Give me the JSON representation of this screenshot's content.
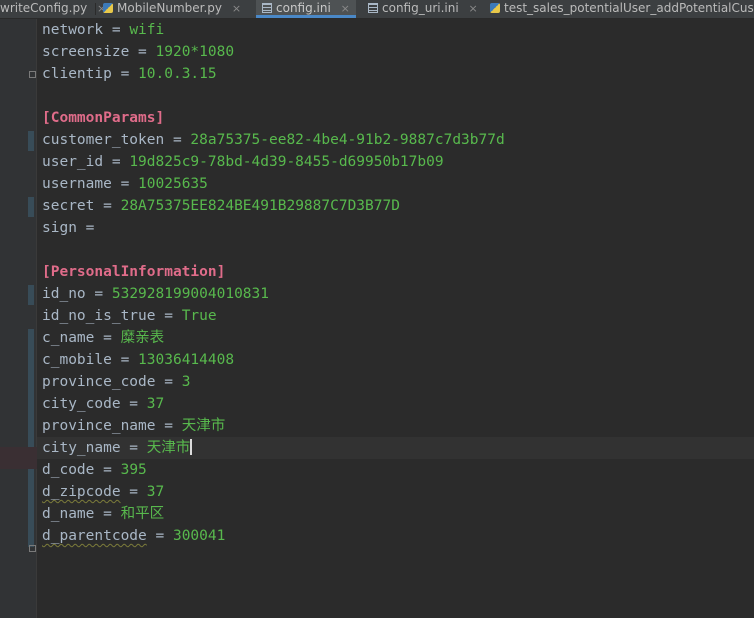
{
  "tabs": [
    {
      "label": "writeConfig.py",
      "icon": "python-file-icon",
      "active": false
    },
    {
      "label": "MobileNumber.py",
      "icon": "python-file-icon",
      "active": false
    },
    {
      "label": "config.ini",
      "icon": "ini-file-icon",
      "active": true
    },
    {
      "label": "config_uri.ini",
      "icon": "ini-file-icon",
      "active": false
    },
    {
      "label": "test_sales_potentialUser_addPotentialCusto",
      "icon": "python-file-icon",
      "active": false
    }
  ],
  "close_glyph": "×",
  "lines": [
    {
      "key": "network",
      "sep": " = ",
      "value": "wifi"
    },
    {
      "key": "screensize",
      "sep": " = ",
      "value": "1920*1080"
    },
    {
      "key": "clientip",
      "sep": " = ",
      "value": "10.0.3.15"
    },
    {
      "section": ""
    },
    {
      "section": "[CommonParams]"
    },
    {
      "key": "customer_token",
      "sep": " = ",
      "value": "28a75375-ee82-4be4-91b2-9887c7d3b77d"
    },
    {
      "key": "user_id",
      "sep": " = ",
      "value": "19d825c9-78bd-4d39-8455-d69950b17b09"
    },
    {
      "key": "username",
      "sep": " = ",
      "value": "10025635"
    },
    {
      "key": "secret",
      "sep": " = ",
      "value": "28A75375EE824BE491B29887C7D3B77D"
    },
    {
      "key": "sign",
      "sep": " =",
      "value": ""
    },
    {
      "section": ""
    },
    {
      "section": "[PersonalInformation]"
    },
    {
      "key": "id_no",
      "sep": " = ",
      "value": "532928199004010831"
    },
    {
      "key": "id_no_is_true",
      "sep": " = ",
      "value": "True"
    },
    {
      "key": "c_name",
      "sep": " = ",
      "value": "糜亲表"
    },
    {
      "key": "c_mobile",
      "sep": " = ",
      "value": "13036414408"
    },
    {
      "key": "province_code",
      "sep": " = ",
      "value": "3"
    },
    {
      "key": "city_code",
      "sep": " = ",
      "value": "37"
    },
    {
      "key": "province_name",
      "sep": " = ",
      "value": "天津市"
    },
    {
      "key": "city_name",
      "sep": " = ",
      "value": "天津市"
    },
    {
      "key": "d_code",
      "sep": " = ",
      "value": "395"
    },
    {
      "key": "d_zipcode",
      "sep": " = ",
      "value": "37"
    },
    {
      "key": "d_name",
      "sep": " = ",
      "value": "和平区"
    },
    {
      "key": "d_parentcode",
      "sep": " = ",
      "value": "300041"
    }
  ],
  "colors": {
    "background": "#2b2b2b",
    "key": "#a9b7c6",
    "value": "#58b94d",
    "section": "#e06c8a",
    "accent": "#4a88c7"
  }
}
